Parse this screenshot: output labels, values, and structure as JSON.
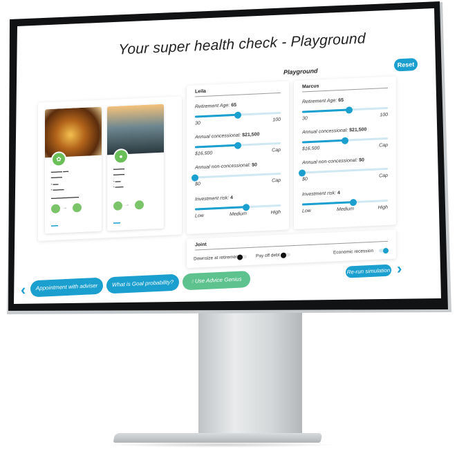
{
  "page": {
    "title": "Your super health check - Playground",
    "reset_label": "Reset",
    "playground_label": "Playground"
  },
  "goal_cards": [
    {
      "image": "golden-nest-eggs",
      "icon": "leaf-icon"
    },
    {
      "image": "car-on-road",
      "icon": "car-icon"
    }
  ],
  "panels": {
    "leila": {
      "name": "Leila",
      "retirement_age": {
        "label": "Retirement Age:",
        "value": "65",
        "min_label": "30",
        "max_label": "100",
        "fraction": 0.5
      },
      "annual_concessional": {
        "label": "Annual concessional:",
        "value": "$21,500",
        "min_label": "$16,500",
        "max_label": "Cap",
        "fraction": 0.5
      },
      "annual_non_concessional": {
        "label": "Annual non-concessional:",
        "value": "$0",
        "min_label": "$0",
        "max_label": "Cap",
        "fraction": 0.0
      },
      "investment_risk": {
        "label": "Investment risk:",
        "value": "4",
        "min_label": "Low",
        "mid_label": "Medium",
        "max_label": "High",
        "fraction": 0.6
      }
    },
    "marcus": {
      "name": "Marcus",
      "retirement_age": {
        "label": "Retirement Age:",
        "value": "65",
        "min_label": "30",
        "max_label": "100",
        "fraction": 0.55
      },
      "annual_concessional": {
        "label": "Annual concessional:",
        "value": "$21,500",
        "min_label": "$16,500",
        "max_label": "Cap",
        "fraction": 0.5
      },
      "annual_non_concessional": {
        "label": "Annual non-concessional:",
        "value": "$0",
        "min_label": "$0",
        "max_label": "Cap",
        "fraction": 0.0
      },
      "investment_risk": {
        "label": "Investment risk:",
        "value": "4",
        "min_label": "Low",
        "mid_label": "Medium",
        "max_label": "High",
        "fraction": 0.6
      }
    },
    "joint": {
      "name": "Joint",
      "downsize_label": "Downsize at retirement",
      "downsize_on": false,
      "pay_off_debt_label": "Pay off debt",
      "pay_off_debt_on": false,
      "recession_label": "Economic recession",
      "recession_on": true
    }
  },
  "actions": {
    "appointment_label": "Appointment with adviser",
    "goal_probability_label": "What is Goal probability?",
    "advice_genius_label": "Use Advice Genius",
    "rerun_label": "Re-run simulation"
  },
  "colors": {
    "accent": "#1a9fcf",
    "green": "#5ec28f",
    "track_bg": "#cfe8f2"
  }
}
